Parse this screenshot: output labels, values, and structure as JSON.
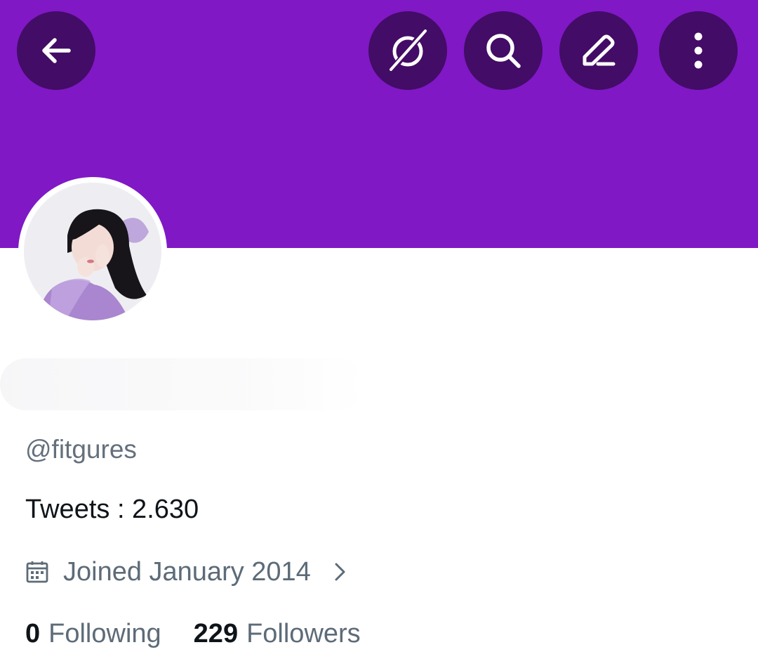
{
  "colors": {
    "banner": "#8018c6",
    "header_button_bg": "#430c66",
    "icon": "#ffffff",
    "secondary_text": "#5d6b78",
    "primary_text": "#0f1419"
  },
  "header": {
    "back_icon": "arrow-left-icon",
    "actions": [
      {
        "icon": "premium-orbit-icon"
      },
      {
        "icon": "search-icon"
      },
      {
        "icon": "edit-pencil-icon"
      },
      {
        "icon": "more-vertical-icon"
      }
    ]
  },
  "profile": {
    "avatar_icon": "profile-photo",
    "display_name": "",
    "handle": "@fitgures",
    "tweets_line": "Tweets : 2.630",
    "joined_icon": "calendar-icon",
    "joined": "Joined January 2014",
    "following_count": "0",
    "following_label": "Following",
    "followers_count": "229",
    "followers_label": "Followers"
  }
}
